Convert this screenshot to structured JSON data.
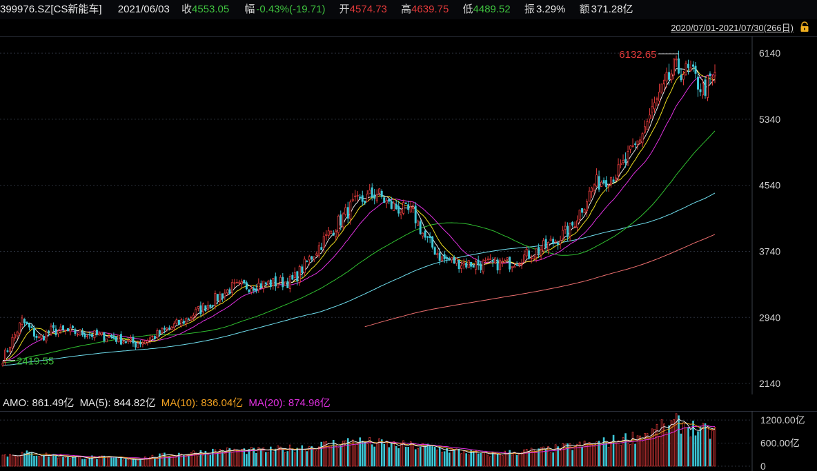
{
  "header": {
    "code": "399976.SZ[CS新能车]",
    "date": "2021/06/03",
    "close_label": "收",
    "close": "4553.05",
    "change_label": "幅",
    "change": "-0.43%(-19.71)",
    "open_label": "开",
    "open": "4574.73",
    "high_label": "高",
    "high": "4639.75",
    "low_label": "低",
    "low": "4489.52",
    "amp_label": "振",
    "amp": "3.29%",
    "amt_label": "额",
    "amt": "371.28亿"
  },
  "range_label": "2020/07/01-2021/07/30(266日)",
  "volume_header": {
    "amo": "AMO: 861.49亿",
    "ma5": "MA(5): 844.82亿",
    "ma10": "MA(10): 836.04亿",
    "ma20": "MA(20): 874.96亿"
  },
  "colors": {
    "up": "#e23a3a",
    "down": "#3ec8d8",
    "ma5": "#e8e8e8",
    "ma10": "#f0e020",
    "ma20": "#e030e0",
    "ma60": "#30c030",
    "ma120": "#70e0f0",
    "ma250": "#f07070",
    "vol_ma10": "#f0a020",
    "vol_ma20": "#e030e0"
  },
  "chart_data": [
    {
      "type": "candlestick",
      "title": "",
      "xlabel": "",
      "ylabel": "",
      "yticks": [
        2140,
        2940,
        3740,
        4540,
        5340,
        6140
      ],
      "ytick_labels": [
        "2140",
        "2940",
        "3740",
        "4540",
        "5340",
        "6140"
      ],
      "ylim": [
        2040,
        6300
      ],
      "x_range": [
        "2020/07/01",
        "2021/07/30"
      ],
      "annotations": [
        {
          "text": "6132.65",
          "kind": "max",
          "value": 6132.65
        },
        {
          "text": "2419.55",
          "kind": "min",
          "value": 2419.55
        }
      ],
      "close_path_keypoints": [
        [
          0,
          2440
        ],
        [
          8,
          2900
        ],
        [
          15,
          2680
        ],
        [
          20,
          2780
        ],
        [
          30,
          2760
        ],
        [
          45,
          2700
        ],
        [
          55,
          2620
        ],
        [
          62,
          2700
        ],
        [
          75,
          2900
        ],
        [
          85,
          3100
        ],
        [
          95,
          3300
        ],
        [
          110,
          3350
        ],
        [
          120,
          3380
        ],
        [
          135,
          3950
        ],
        [
          145,
          4300
        ],
        [
          155,
          4450
        ],
        [
          160,
          4300
        ],
        [
          170,
          4200
        ],
        [
          175,
          3900
        ],
        [
          182,
          3650
        ],
        [
          190,
          3600
        ],
        [
          200,
          3580
        ],
        [
          210,
          3600
        ],
        [
          225,
          3800
        ],
        [
          235,
          4000
        ],
        [
          245,
          4550
        ],
        [
          255,
          4700
        ],
        [
          262,
          5000
        ],
        [
          270,
          5500
        ],
        [
          278,
          5950
        ],
        [
          285,
          5900
        ],
        [
          290,
          5700
        ],
        [
          295,
          5850
        ]
      ],
      "n_bars": 296,
      "series": [
        {
          "name": "MA5"
        },
        {
          "name": "MA10"
        },
        {
          "name": "MA20"
        },
        {
          "name": "MA60"
        },
        {
          "name": "MA120"
        },
        {
          "name": "MA250"
        }
      ]
    },
    {
      "type": "bar",
      "title": "",
      "yticks": [
        0,
        600,
        1200
      ],
      "ytick_labels": [
        "0",
        "600.00亿",
        "1200.00亿"
      ],
      "ylim": [
        0,
        1400
      ],
      "volume_keypoints": [
        [
          0,
          280
        ],
        [
          10,
          330
        ],
        [
          30,
          240
        ],
        [
          55,
          190
        ],
        [
          70,
          300
        ],
        [
          90,
          400
        ],
        [
          110,
          400
        ],
        [
          130,
          520
        ],
        [
          145,
          650
        ],
        [
          160,
          560
        ],
        [
          175,
          500
        ],
        [
          200,
          300
        ],
        [
          225,
          420
        ],
        [
          250,
          620
        ],
        [
          265,
          800
        ],
        [
          280,
          1120
        ],
        [
          290,
          900
        ],
        [
          295,
          860
        ]
      ],
      "series": [
        {
          "name": "AMO"
        },
        {
          "name": "MA(5)"
        },
        {
          "name": "MA(10)"
        },
        {
          "name": "MA(20)"
        }
      ]
    }
  ]
}
